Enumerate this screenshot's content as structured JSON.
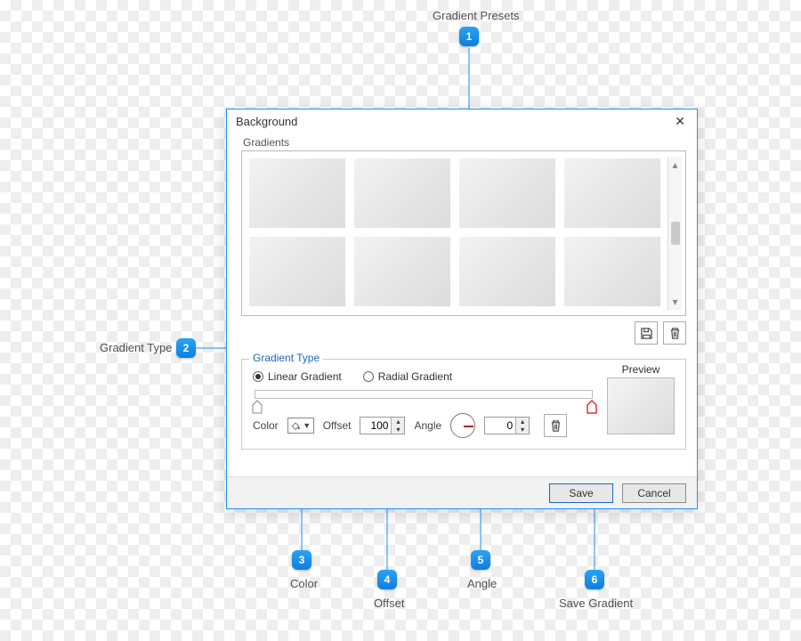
{
  "callouts": {
    "c1": {
      "num": "1",
      "label": "Gradient Presets"
    },
    "c2": {
      "num": "2",
      "label": "Gradient Type"
    },
    "c3": {
      "num": "3",
      "label": "Color"
    },
    "c4": {
      "num": "4",
      "label": "Offset"
    },
    "c5": {
      "num": "5",
      "label": "Angle"
    },
    "c6": {
      "num": "6",
      "label": "Save Gradient"
    }
  },
  "dialog": {
    "title": "Background",
    "gradients_label": "Gradients",
    "group_title": "Gradient Type",
    "radio_linear": "Linear Gradient",
    "radio_radial": "Radial Gradient",
    "preview_label": "Preview",
    "color_label": "Color",
    "offset_label": "Offset",
    "offset_value": "100",
    "angle_label": "Angle",
    "angle_value": "0",
    "save": "Save",
    "cancel": "Cancel"
  }
}
